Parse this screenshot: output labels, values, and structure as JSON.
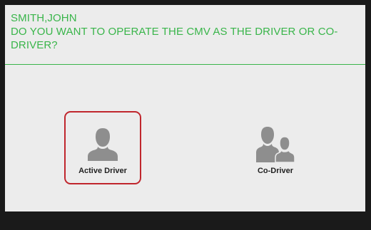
{
  "header": {
    "driver_name": "SMITH,JOHN",
    "question": "DO YOU WANT TO OPERATE THE CMV AS THE DRIVER OR CO-DRIVER?"
  },
  "options": [
    {
      "label": "Active Driver",
      "icon": "person-icon",
      "selected": true
    },
    {
      "label": "Co-Driver",
      "icon": "two-people-icon",
      "selected": false
    }
  ],
  "colors": {
    "accent": "#39b54a",
    "selection": "#c0262d",
    "icon": "#8e8e8e",
    "background": "#ececec"
  }
}
